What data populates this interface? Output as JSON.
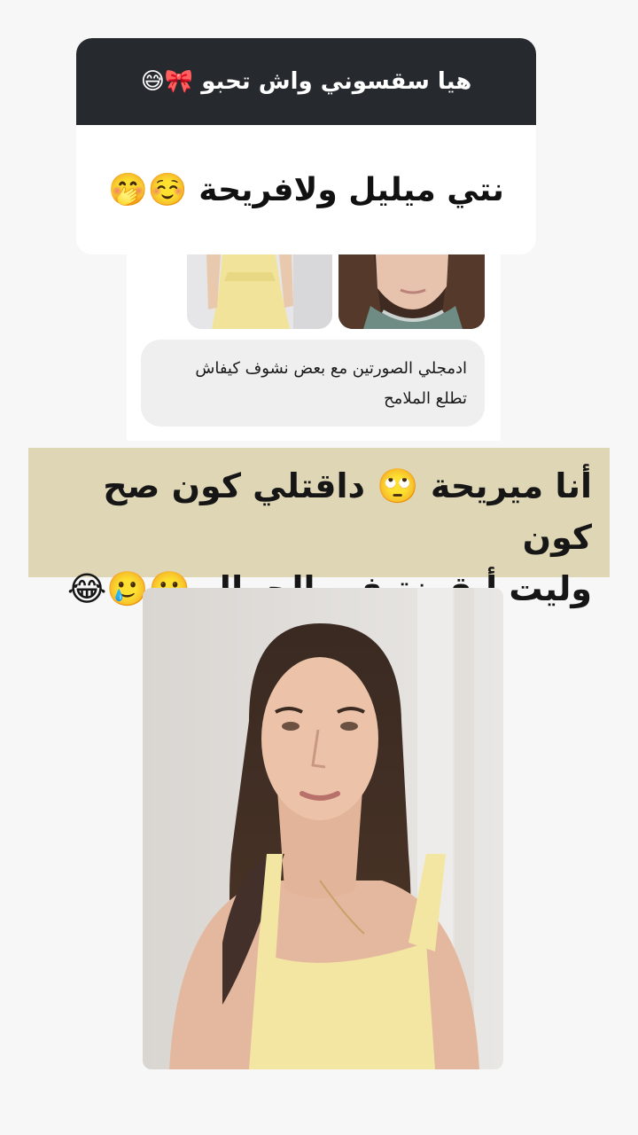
{
  "question_box": {
    "question": "هيا سقسوني واش تحبو 🎀😅",
    "answer": "نتي ميليل ولافريحة ☺️🤭"
  },
  "chat": {
    "message_line1": "ادمجلي الصورتين مع بعض نشوف كيفاش",
    "message_line2": "تطلع الملامح"
  },
  "banner": {
    "line1": "أنا ميريحة 🙄  داقتلي كون صح كون",
    "line2": "وليت أيقونة في الجمال 🥲🥲😂"
  },
  "colors": {
    "header_bg": "#262a2f",
    "banner_bg": "#dfd6b6",
    "bubble_bg": "#efefef",
    "page_bg": "#f7f7f7"
  }
}
